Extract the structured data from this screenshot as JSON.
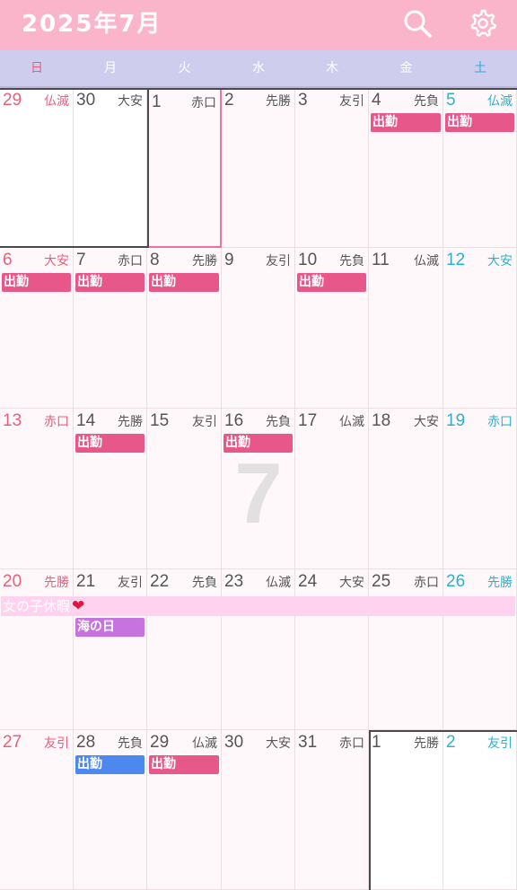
{
  "header": {
    "title": "2025年7月",
    "search_icon": "search-icon",
    "settings_icon": "gear-icon"
  },
  "colors": {
    "header_bg": "#fbb5ca",
    "weekbar_bg": "#cfcdee",
    "sunday": "#e8607b",
    "saturday": "#2db0d0",
    "shift_pink": "#e8578a",
    "shift_blue": "#4c88ee",
    "holiday_purple": "#c673df",
    "multi_day_pink": "#ffd3ef"
  },
  "weekdays": [
    "日",
    "月",
    "火",
    "水",
    "木",
    "金",
    "土"
  ],
  "watermark": "7",
  "multi_day_event": {
    "label": "女の子休暇",
    "icon": "heart-icon",
    "glyph": "❤"
  },
  "weeks": [
    [
      {
        "day": "29",
        "rokuyo": "仏滅",
        "other": true
      },
      {
        "day": "30",
        "rokuyo": "大安",
        "other": true
      },
      {
        "day": "1",
        "rokuyo": "赤口",
        "today": true
      },
      {
        "day": "2",
        "rokuyo": "先勝"
      },
      {
        "day": "3",
        "rokuyo": "友引"
      },
      {
        "day": "4",
        "rokuyo": "先負",
        "event": "出勤"
      },
      {
        "day": "5",
        "rokuyo": "仏滅",
        "event": "出勤"
      }
    ],
    [
      {
        "day": "6",
        "rokuyo": "大安",
        "event": "出勤"
      },
      {
        "day": "7",
        "rokuyo": "赤口",
        "event": "出勤"
      },
      {
        "day": "8",
        "rokuyo": "先勝",
        "event": "出勤"
      },
      {
        "day": "9",
        "rokuyo": "友引"
      },
      {
        "day": "10",
        "rokuyo": "先負",
        "event": "出勤"
      },
      {
        "day": "11",
        "rokuyo": "仏滅"
      },
      {
        "day": "12",
        "rokuyo": "大安"
      }
    ],
    [
      {
        "day": "13",
        "rokuyo": "赤口"
      },
      {
        "day": "14",
        "rokuyo": "先勝",
        "event": "出勤"
      },
      {
        "day": "15",
        "rokuyo": "友引"
      },
      {
        "day": "16",
        "rokuyo": "先負",
        "event": "出勤"
      },
      {
        "day": "17",
        "rokuyo": "仏滅"
      },
      {
        "day": "18",
        "rokuyo": "大安"
      },
      {
        "day": "19",
        "rokuyo": "赤口"
      }
    ],
    [
      {
        "day": "20",
        "rokuyo": "先勝"
      },
      {
        "day": "21",
        "rokuyo": "友引",
        "event": "海の日",
        "event_style": "purple"
      },
      {
        "day": "22",
        "rokuyo": "先負"
      },
      {
        "day": "23",
        "rokuyo": "仏滅"
      },
      {
        "day": "24",
        "rokuyo": "大安"
      },
      {
        "day": "25",
        "rokuyo": "赤口"
      },
      {
        "day": "26",
        "rokuyo": "先勝"
      }
    ],
    [
      {
        "day": "27",
        "rokuyo": "友引"
      },
      {
        "day": "28",
        "rokuyo": "先負",
        "event": "出勤",
        "event_style": "blue"
      },
      {
        "day": "29",
        "rokuyo": "仏滅",
        "event": "出勤"
      },
      {
        "day": "30",
        "rokuyo": "大安"
      },
      {
        "day": "31",
        "rokuyo": "赤口"
      },
      {
        "day": "1",
        "rokuyo": "先勝",
        "other": true
      },
      {
        "day": "2",
        "rokuyo": "友引",
        "other": true
      }
    ]
  ]
}
